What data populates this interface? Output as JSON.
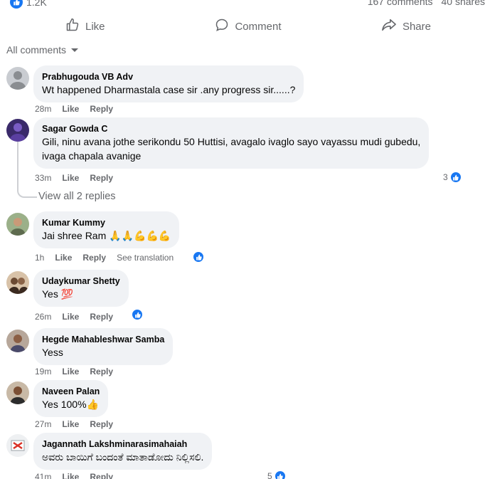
{
  "post": {
    "reaction_count": "1.2K",
    "comments_count": "167 comments",
    "shares_count": "40 shares"
  },
  "actions": {
    "like": "Like",
    "comment": "Comment",
    "share": "Share"
  },
  "filter": {
    "label": "All comments"
  },
  "labels": {
    "like": "Like",
    "reply": "Reply",
    "see_translation": "See translation"
  },
  "comments": [
    {
      "author": "Prabhugouda VB Adv",
      "lines": [
        "Wt happened Dharmastala case sir .any progress sir......?"
      ],
      "time": "28m"
    },
    {
      "author": "Sagar Gowda C",
      "lines": [
        "Gili, ninu avana jothe serikondu 50 Huttisi, avagalo ivaglo sayo vayassu mudi gubedu,",
        "ivaga chapala avanige"
      ],
      "time": "33m",
      "reactions": "3",
      "view_replies": "View all 2 replies"
    },
    {
      "author": "Kumar Kummy",
      "lines": [
        "Jai shree Ram 🙏🙏💪💪💪"
      ],
      "time": "1h"
    },
    {
      "author": "Udaykumar Shetty",
      "lines": [
        "Yes 💯"
      ],
      "time": "26m"
    },
    {
      "author": "Hegde Mahableshwar Samba",
      "lines": [
        "Yess"
      ],
      "time": "19m"
    },
    {
      "author": "Naveen Palan",
      "lines": [
        "Yes 100%👍"
      ],
      "time": "27m"
    },
    {
      "author": "Jagannath Lakshminarasimahaiah",
      "lines": [
        "ಅವರು ಬಾಯಿಗೆ ಬಂದಂತೆ ಮಾತಾಡೋದು ನಿಲ್ಲಿಸಲಿ."
      ],
      "time": "41m",
      "reactions": "5"
    }
  ],
  "colors": {
    "accent": "#1877f2",
    "bubble": "#f0f2f5",
    "muted": "#65676b"
  }
}
